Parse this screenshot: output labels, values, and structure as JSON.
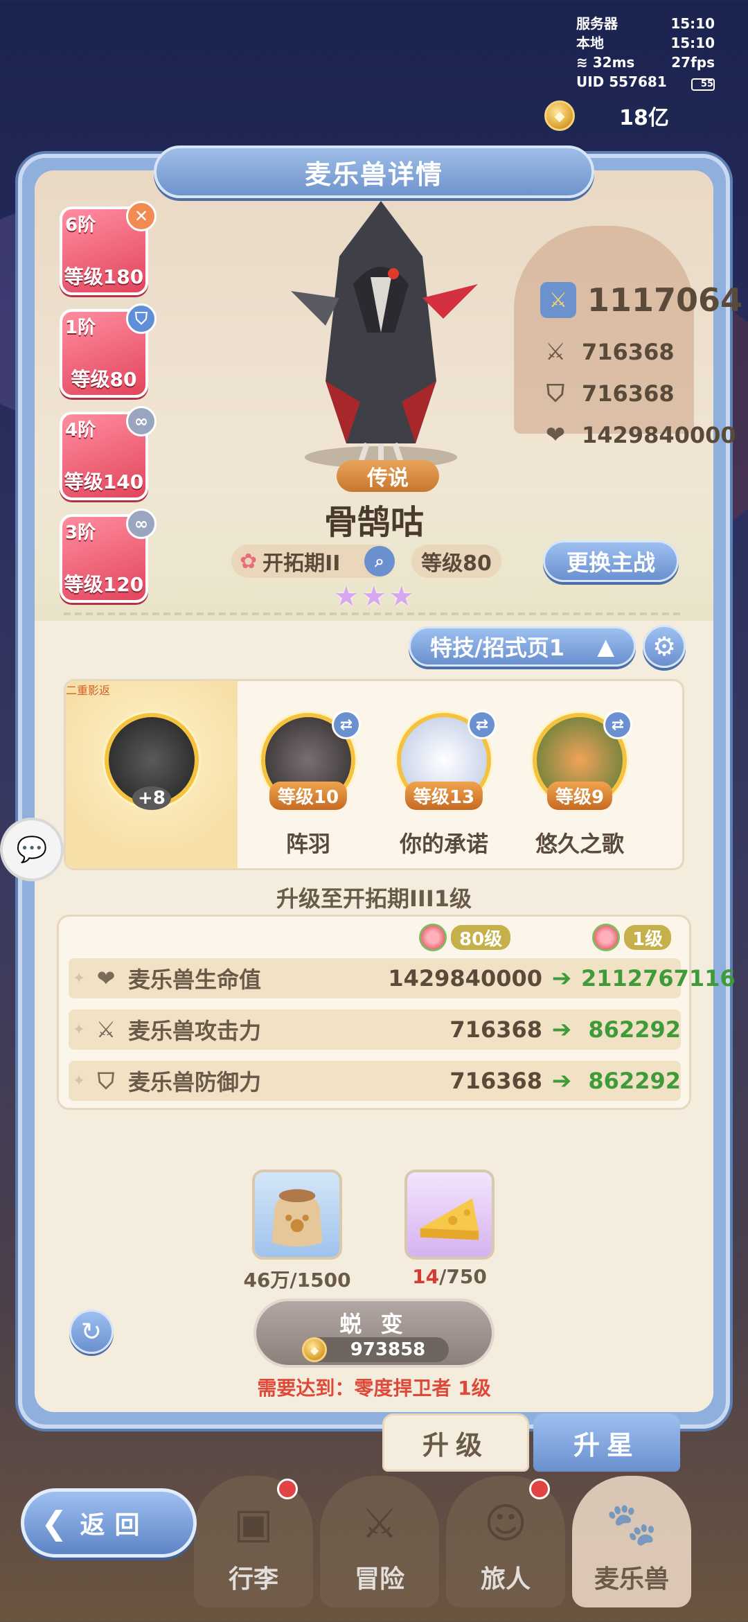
{
  "status": {
    "server_label": "服务器",
    "server_time": "15:10",
    "local_label": "本地",
    "local_time": "15:10",
    "ping": "32ms",
    "fps": "27fps",
    "uid": "UID 557681",
    "battery": "55"
  },
  "currency": {
    "gold": "18亿"
  },
  "panel": {
    "title": "麦乐兽详情"
  },
  "badges": [
    {
      "tier": "6阶",
      "level": "等级180",
      "mark": "✕",
      "mark_icon": "cross-icon",
      "mark_color": "#f28b52"
    },
    {
      "tier": "1阶",
      "level": "等级80",
      "mark": "⛉",
      "mark_icon": "shield-icon",
      "mark_color": "#5f8fd8"
    },
    {
      "tier": "4阶",
      "level": "等级140",
      "mark": "∞",
      "mark_icon": "link-icon",
      "mark_color": "#9aa6c0"
    },
    {
      "tier": "3阶",
      "level": "等级120",
      "mark": "∞",
      "mark_icon": "link-icon",
      "mark_color": "#9aa6c0"
    }
  ],
  "stats": {
    "power": "1117064",
    "attack": "716368",
    "defense": "716368",
    "hp": "1429840000"
  },
  "creature": {
    "rarity": "传说",
    "name": "骨鹄咕",
    "stage": "开拓期II",
    "level": "等级80",
    "stars": [
      "★",
      "★",
      "★"
    ]
  },
  "buttons": {
    "swap_main": "更换主战",
    "skill_page": "特技/招式页1",
    "evolve": "蜕 变",
    "evolve_cost": "973858"
  },
  "skills": [
    {
      "name": "二重影返",
      "level": "+8",
      "color": "#2c2a2a"
    },
    {
      "name": "阵羽",
      "level": "等级10",
      "color": "#3a3436"
    },
    {
      "name": "你的承诺",
      "level": "等级13",
      "color": "#cfd8ea"
    },
    {
      "name": "悠久之歌",
      "level": "等级9",
      "color": "#5c8a3c"
    }
  ],
  "upgrade": {
    "title": "升级至开拓期III1级",
    "from_level": "80级",
    "to_level": "1级",
    "rows": [
      {
        "label": "麦乐兽生命值",
        "old": "1429840000",
        "new": "2112767116",
        "icon": "heart-icon",
        "glyph": "❤"
      },
      {
        "label": "麦乐兽攻击力",
        "old": "716368",
        "new": "862292",
        "icon": "swords-icon",
        "glyph": "⚔"
      },
      {
        "label": "麦乐兽防御力",
        "old": "716368",
        "new": "862292",
        "icon": "shield-icon",
        "glyph": "⛉"
      }
    ]
  },
  "materials": [
    {
      "have": "46万",
      "need": "/1500",
      "have_color": "#6a5a4a",
      "bg": "#bcd6f2"
    },
    {
      "have": "14",
      "need": "/750",
      "have_color": "#d23c32",
      "bg": "#e2c9f2"
    }
  ],
  "requirement": "需要达到：零度捍卫者 1级",
  "tabs": {
    "upgrade": "升级",
    "star": "升星"
  },
  "nav": {
    "back": "返回",
    "bag": "行李",
    "adventure": "冒险",
    "traveler": "旅人",
    "pets": "麦乐兽"
  }
}
